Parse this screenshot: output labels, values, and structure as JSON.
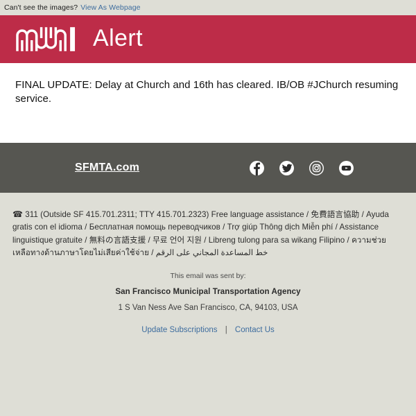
{
  "prehead": {
    "notice": "Can't see the images?",
    "link_label": "View As Webpage"
  },
  "masthead": {
    "logo_name": "muni",
    "title": "Alert",
    "background_color": "#bd2c48"
  },
  "message": {
    "text": "FINAL UPDATE: Delay at Church and 16th has cleared. IB/OB #JChurch resuming service."
  },
  "footer": {
    "site_link": "SFMTA.com",
    "background_color": "#565651",
    "social": [
      {
        "name": "facebook",
        "label": "Facebook"
      },
      {
        "name": "twitter",
        "label": "Twitter"
      },
      {
        "name": "instagram",
        "label": "Instagram"
      },
      {
        "name": "youtube",
        "label": "YouTube"
      }
    ]
  },
  "language_assistance": {
    "phone_glyph": "☎",
    "line": " 311 (Outside SF 415.701.2311; TTY 415.701.2323) Free language assistance / 免費語言協助 / Ayuda gratis con el idioma / Бесплатная помощь переводчиков / Trợ giúp Thông dịch Miễn phí / Assistance linguistique gratuite / 無料の言語支援 / 무료 언어 지원 / Libreng tulong para sa wikang Filipino / ความช่วยเหลือทางด้านภาษาโดยไม่เสียค่าใช้จ่าย / خط المساعدة المجاني على الرقم"
  },
  "sent_by": {
    "prefix": "This email was sent by:",
    "organization": "San Francisco Municipal Transportation Agency",
    "address": "1 S Van Ness Ave San Francisco, CA, 94103, USA"
  },
  "bottom_links": {
    "update": "Update Subscriptions",
    "separator": "|",
    "contact": "Contact Us"
  }
}
